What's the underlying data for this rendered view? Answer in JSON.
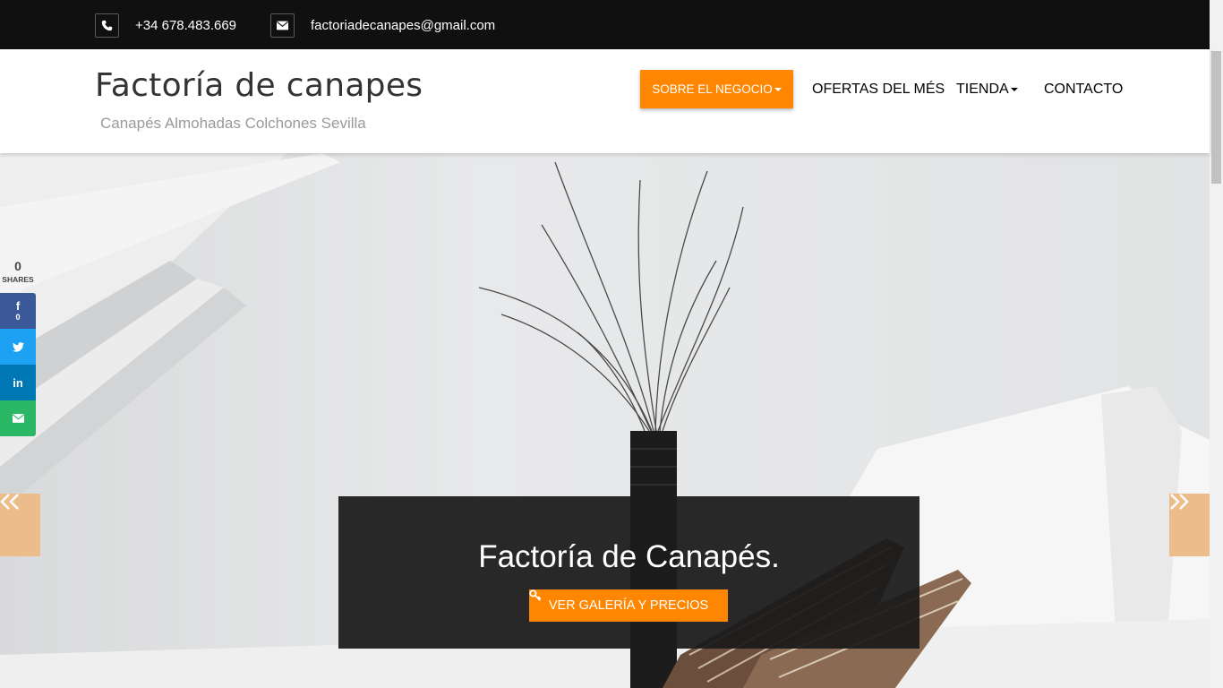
{
  "topbar": {
    "phone": "+34 678.483.669",
    "email": "factoriadecanapes@gmail.com",
    "phone_icon": "phone-icon",
    "email_icon": "envelope-icon"
  },
  "header": {
    "site_title": "Factoría de canapes",
    "tagline": "Canapés Almohadas Colchones Sevilla"
  },
  "nav": {
    "items": [
      {
        "label": "SOBRE EL NEGOCIO",
        "dropdown": true,
        "active": true
      },
      {
        "label": "OFERTAS DEL MÉS",
        "dropdown": false
      },
      {
        "label": "TIENDA",
        "dropdown": true
      },
      {
        "label": "CONTACTO",
        "dropdown": false
      }
    ]
  },
  "hero": {
    "caption_title": "Factoría de Canapés.",
    "button_label": "VER GALERÍA Y PRECIOS",
    "button_icon": "key-icon",
    "prev_icon": "double-chevron-left-icon",
    "next_icon": "double-chevron-right-icon"
  },
  "share": {
    "count": "0",
    "label": "SHARES",
    "facebook_count": "0",
    "buttons": [
      "facebook",
      "twitter",
      "linkedin",
      "email"
    ]
  },
  "colors": {
    "accent": "#ff8600",
    "topbar_bg": "#101010",
    "facebook": "#3b5998",
    "twitter": "#1da1f2",
    "linkedin": "#0077b5",
    "email": "#2ab866"
  }
}
